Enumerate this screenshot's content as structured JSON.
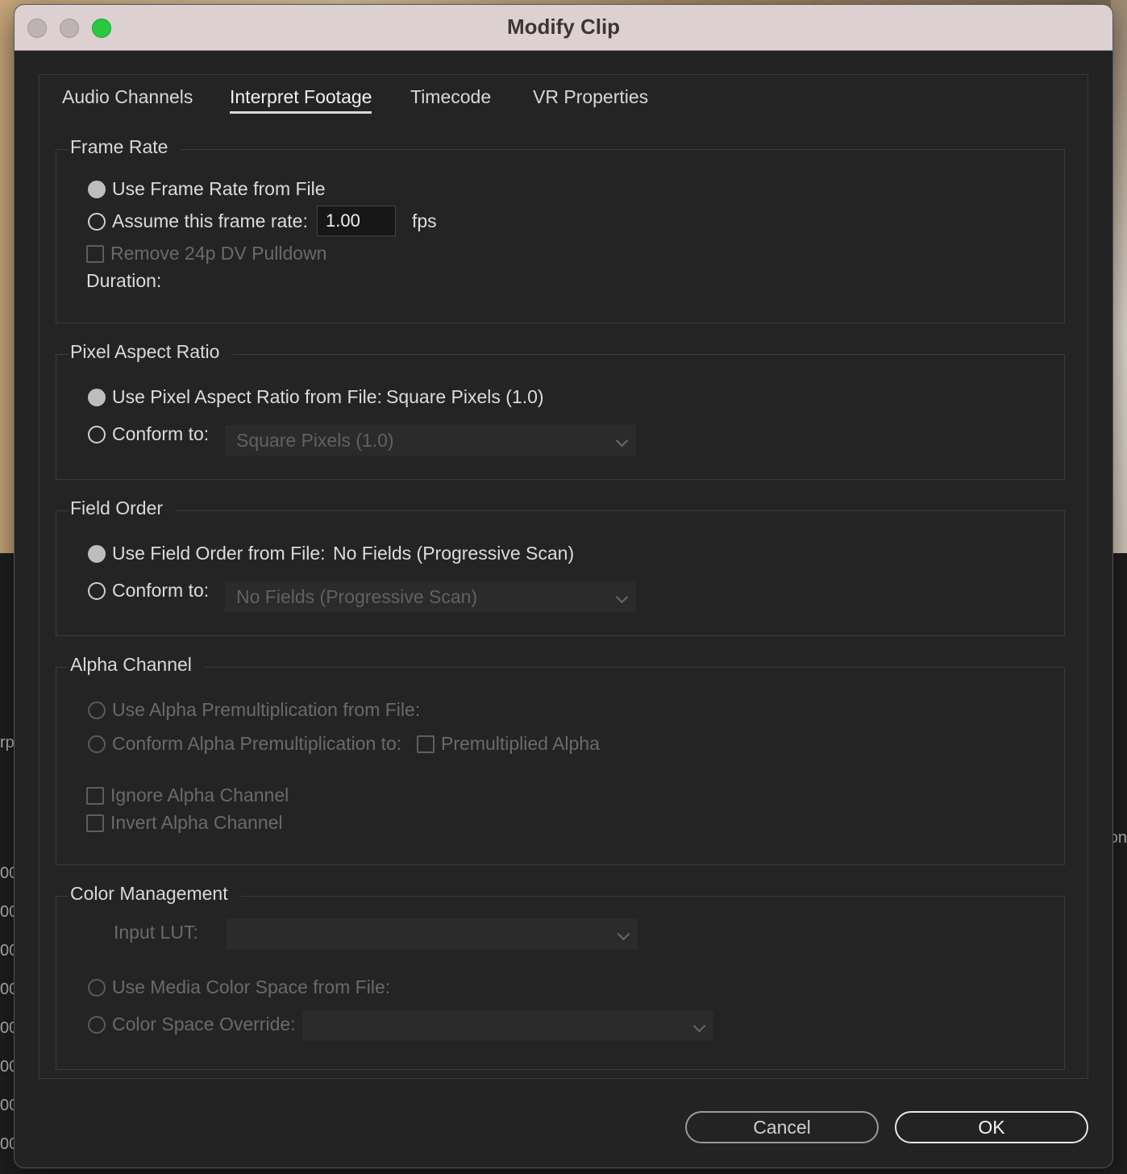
{
  "window": {
    "title": "Modify Clip"
  },
  "tabs": [
    {
      "label": "Audio Channels"
    },
    {
      "label": "Interpret Footage"
    },
    {
      "label": "Timecode"
    },
    {
      "label": "VR Properties"
    }
  ],
  "active_tab": "Interpret Footage",
  "frame_rate": {
    "title": "Frame Rate",
    "use_from_file": "Use Frame Rate from File",
    "assume_label": "Assume this frame rate:",
    "assume_value": "1.00",
    "unit": "fps",
    "remove_pulldown": "Remove 24p DV Pulldown",
    "duration_label": "Duration:"
  },
  "pixel_aspect": {
    "title": "Pixel Aspect Ratio",
    "use_from_file": "Use Pixel Aspect Ratio from File:",
    "file_value": "Square Pixels (1.0)",
    "conform_label": "Conform to:",
    "conform_value": "Square Pixels (1.0)"
  },
  "field_order": {
    "title": "Field Order",
    "use_from_file": "Use Field Order from File:",
    "file_value": "No Fields (Progressive Scan)",
    "conform_label": "Conform to:",
    "conform_value": "No Fields (Progressive Scan)"
  },
  "alpha": {
    "title": "Alpha Channel",
    "use_from_file": "Use Alpha Premultiplication from File:",
    "conform_label": "Conform Alpha Premultiplication to:",
    "premultiplied": "Premultiplied Alpha",
    "ignore": "Ignore Alpha Channel",
    "invert": "Invert Alpha Channel"
  },
  "color": {
    "title": "Color Management",
    "input_lut": "Input LUT:",
    "use_media": "Use Media Color Space from File:",
    "override": "Color Space Override:"
  },
  "buttons": {
    "cancel": "Cancel",
    "ok": "OK"
  },
  "background": {
    "frag_rp": "rp",
    "frag_on": "on",
    "frag_00": "00"
  }
}
